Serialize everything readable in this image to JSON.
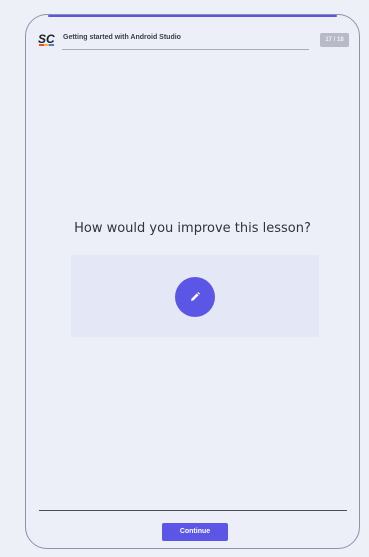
{
  "header": {
    "lesson_title": "Getting started with Android Studio",
    "counter": "17 / 18",
    "logo_icon": "sc-logo-icon"
  },
  "main": {
    "question": "How would you improve this lesson?",
    "edit_icon": "pencil-icon"
  },
  "footer": {
    "continue_label": "Continue"
  },
  "colors": {
    "accent": "#5b56e6",
    "background": "#eef0f8",
    "panel": "#e4e8f6"
  }
}
